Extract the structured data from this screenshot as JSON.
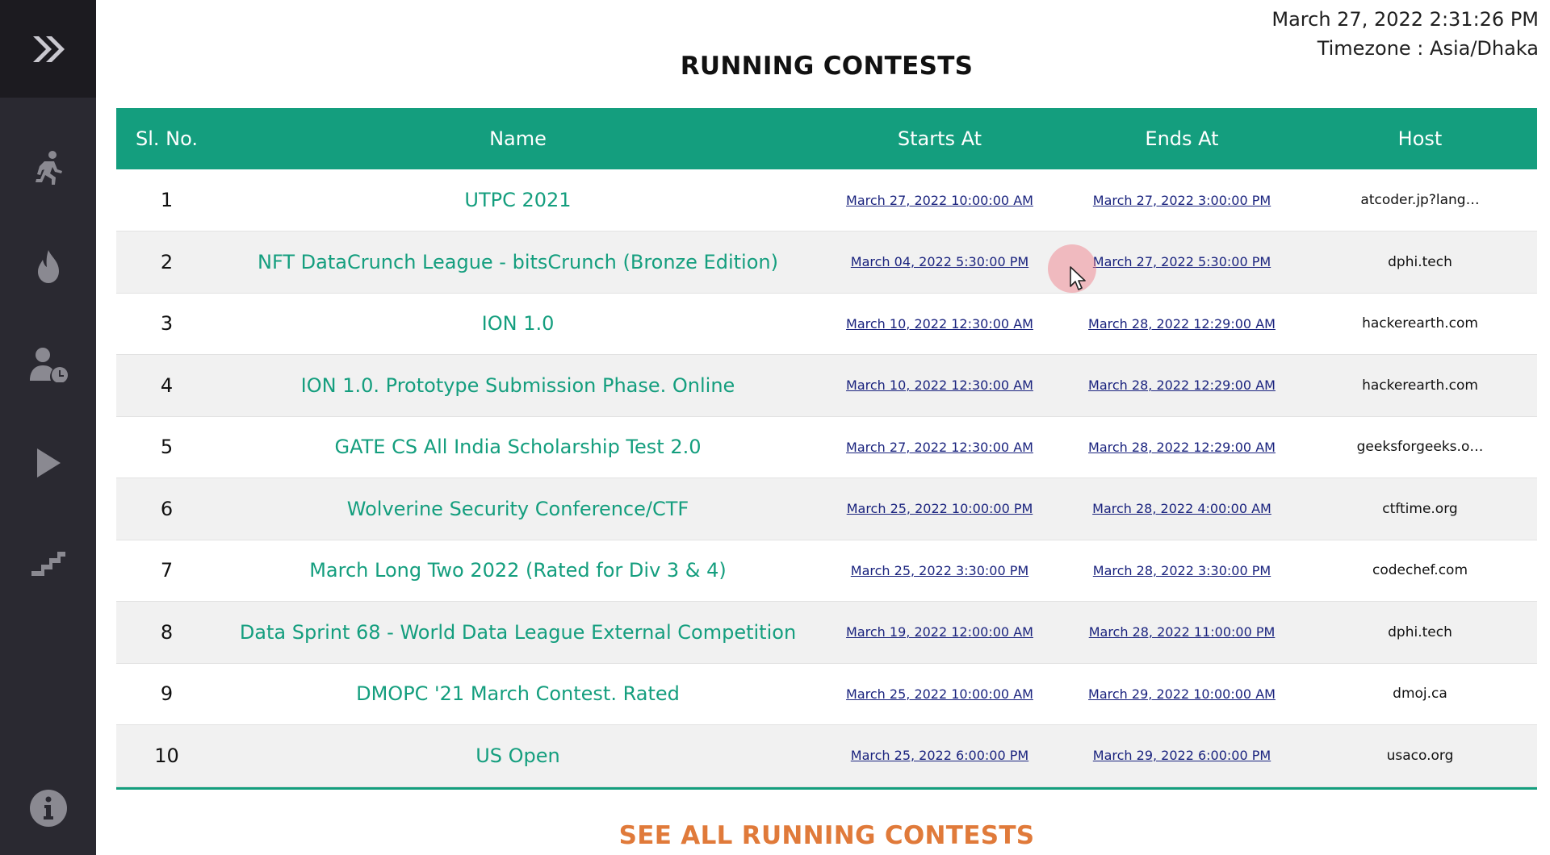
{
  "clock": {
    "datetime": "March 27, 2022 2:31:26 PM",
    "timezone": "Timezone : Asia/Dhaka"
  },
  "page_title": "RUNNING CONTESTS",
  "table": {
    "headers": [
      "Sl. No.",
      "Name",
      "Starts At",
      "Ends At",
      "Host"
    ],
    "rows": [
      {
        "sl": "1",
        "name": "UTPC 2021",
        "start": "March 27, 2022 10:00:00 AM",
        "end": "March 27, 2022 3:00:00 PM",
        "host": "atcoder.jp?lang…"
      },
      {
        "sl": "2",
        "name": "NFT DataCrunch League - bitsCrunch (Bronze Edition)",
        "start": "March 04, 2022 5:30:00 PM",
        "end": "March 27, 2022 5:30:00 PM",
        "host": "dphi.tech"
      },
      {
        "sl": "3",
        "name": "ION 1.0",
        "start": "March 10, 2022 12:30:00 AM",
        "end": "March 28, 2022 12:29:00 AM",
        "host": "hackerearth.com"
      },
      {
        "sl": "4",
        "name": "ION 1.0. Prototype Submission Phase. Online",
        "start": "March 10, 2022 12:30:00 AM",
        "end": "March 28, 2022 12:29:00 AM",
        "host": "hackerearth.com"
      },
      {
        "sl": "5",
        "name": "GATE CS All India Scholarship Test 2.0",
        "start": "March 27, 2022 12:30:00 AM",
        "end": "March 28, 2022 12:29:00 AM",
        "host": "geeksforgeeks.o…"
      },
      {
        "sl": "6",
        "name": "Wolverine Security Conference/CTF",
        "start": "March 25, 2022 10:00:00 PM",
        "end": "March 28, 2022 4:00:00 AM",
        "host": "ctftime.org"
      },
      {
        "sl": "7",
        "name": "March Long Two 2022 (Rated for Div 3 & 4)",
        "start": "March 25, 2022 3:30:00 PM",
        "end": "March 28, 2022 3:30:00 PM",
        "host": "codechef.com"
      },
      {
        "sl": "8",
        "name": "Data Sprint 68 - World Data League External Competition",
        "start": "March 19, 2022 12:00:00 AM",
        "end": "March 28, 2022 11:00:00 PM",
        "host": "dphi.tech"
      },
      {
        "sl": "9",
        "name": "DMOPC '21 March Contest. Rated",
        "start": "March 25, 2022 10:00:00 AM",
        "end": "March 29, 2022 10:00:00 AM",
        "host": "dmoj.ca"
      },
      {
        "sl": "10",
        "name": "US Open",
        "start": "March 25, 2022 6:00:00 PM",
        "end": "March 29, 2022 6:00:00 PM",
        "host": "usaco.org"
      }
    ]
  },
  "see_all_label": "SEE ALL RUNNING CONTESTS",
  "sidebar": {
    "icons": [
      "double-chevron-right-icon",
      "running-person-icon",
      "fire-icon",
      "user-clock-icon",
      "play-icon",
      "stairs-icon",
      "info-icon"
    ]
  },
  "colors": {
    "accent": "#149e7e",
    "sidebar_bg": "#2a2931",
    "sidebar_top_bg": "#1c1b20",
    "link_date": "#1a237e",
    "see_all": "#e07a3a"
  }
}
